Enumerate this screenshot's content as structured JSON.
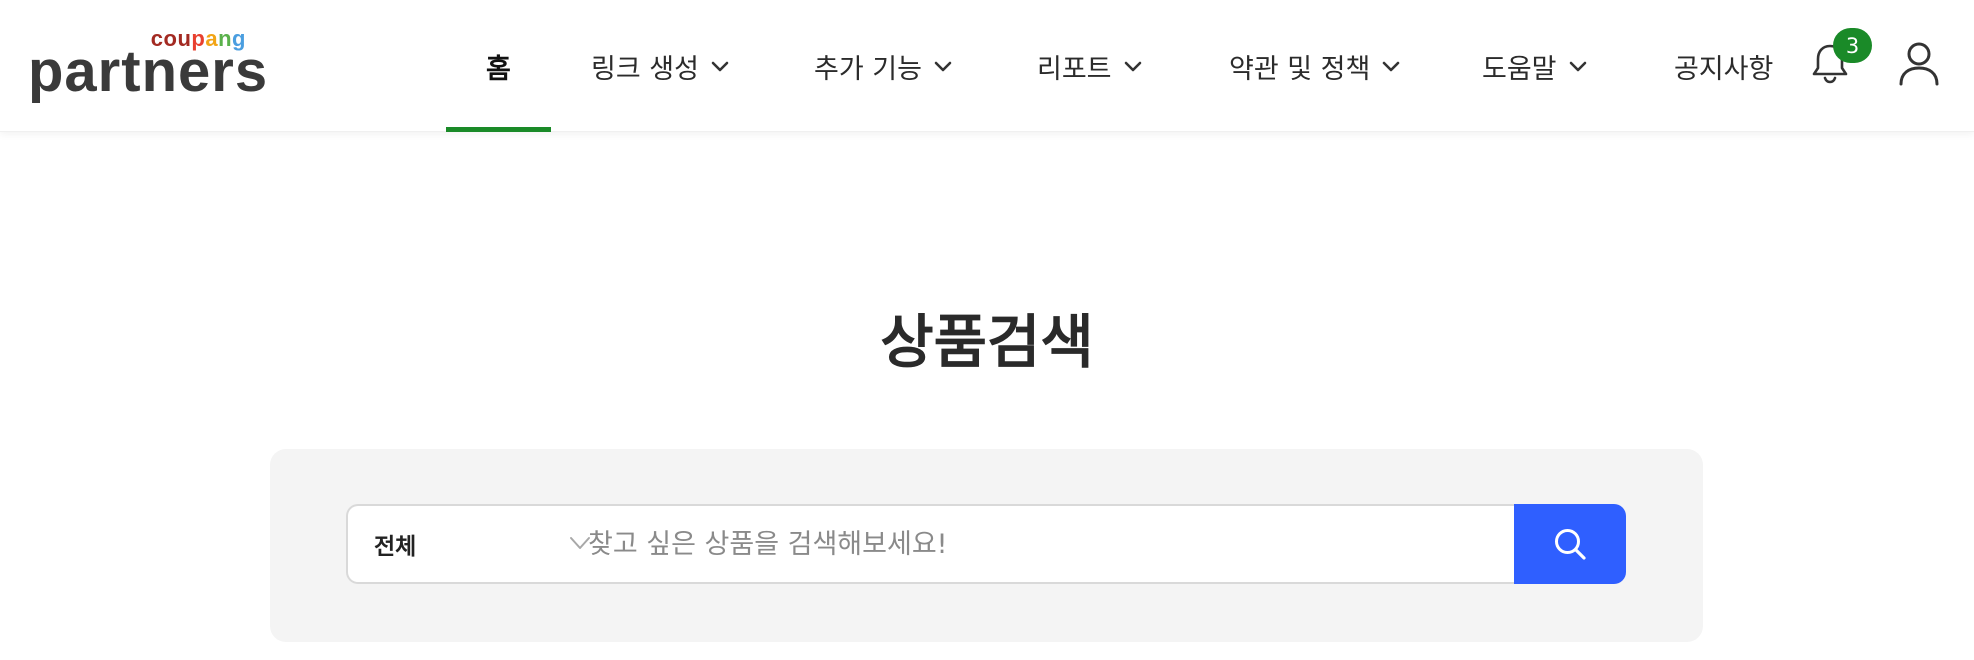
{
  "header": {
    "logo": {
      "brand_small": "coupang",
      "brand_small_letters": [
        {
          "ch": "c",
          "color": "#a32a22"
        },
        {
          "ch": "o",
          "color": "#a32a22"
        },
        {
          "ch": "u",
          "color": "#a32a22"
        },
        {
          "ch": "p",
          "color": "#e8402f"
        },
        {
          "ch": "a",
          "color": "#f2a516"
        },
        {
          "ch": "n",
          "color": "#5ab14b"
        },
        {
          "ch": "g",
          "color": "#4a9ee0"
        }
      ],
      "brand_large": "partners"
    },
    "nav": [
      {
        "label": "홈",
        "has_dropdown": false,
        "active": true
      },
      {
        "label": "링크 생성",
        "has_dropdown": true,
        "active": false
      },
      {
        "label": "추가 기능",
        "has_dropdown": true,
        "active": false
      },
      {
        "label": "리포트",
        "has_dropdown": true,
        "active": false
      },
      {
        "label": "약관 및 정책",
        "has_dropdown": true,
        "active": false
      },
      {
        "label": "도움말",
        "has_dropdown": true,
        "active": false
      },
      {
        "label": "공지사항",
        "has_dropdown": false,
        "active": false
      }
    ],
    "notifications": {
      "count": "3",
      "icon": "bell-icon"
    },
    "user_icon": "user-icon",
    "accent_color": "#1a8a28"
  },
  "main": {
    "title": "상품검색",
    "search": {
      "category_selected": "전체",
      "placeholder": "찾고 싶은 상품을 검색해보세요!",
      "value": "",
      "button_icon": "search-icon",
      "button_color": "#2f5fff"
    }
  }
}
